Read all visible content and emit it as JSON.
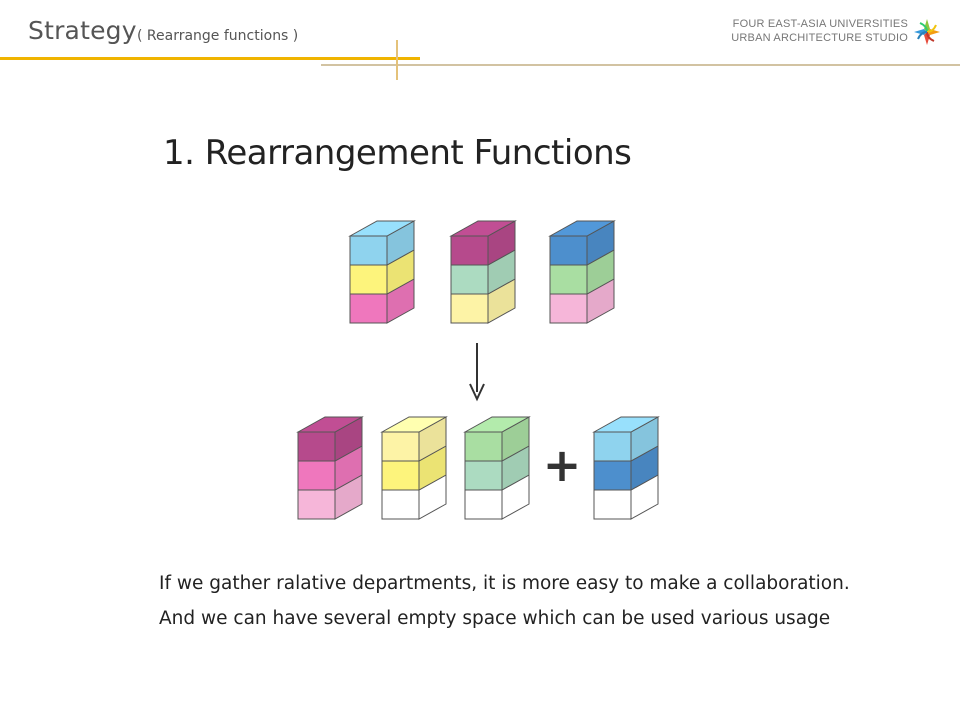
{
  "header": {
    "title": "Strategy",
    "subtitle": "( Rearrange functions )",
    "org_line1": "FOUR EAST-ASIA  UNIVERSITIES",
    "org_line2": "URBAN ARCHITECTURE STUDIO",
    "logo_icon": "four-color-pinwheel-logo"
  },
  "figure": {
    "title": "1. Rearrangement Functions",
    "operator_symbol": "+",
    "arrow_icon": "arrow-down-icon",
    "colors": {
      "cyan": "#8fd3ee",
      "yellow": "#fdf47c",
      "pink": "#ef77bd",
      "magenta": "#b64a8c",
      "mint": "#acdbc1",
      "cream": "#fdf3a6",
      "blue": "#4d8fcd",
      "green": "#a9dea2",
      "light_pink": "#f6b6d9",
      "empty": "#ffffff"
    },
    "stacks_before": [
      [
        "cyan",
        "yellow",
        "pink"
      ],
      [
        "magenta",
        "mint",
        "cream"
      ],
      [
        "blue",
        "green",
        "light_pink"
      ]
    ],
    "stacks_after": [
      [
        "magenta",
        "pink",
        "light_pink"
      ],
      [
        "cream",
        "yellow",
        "empty"
      ],
      [
        "green",
        "mint",
        "empty"
      ],
      [
        "cyan",
        "blue",
        "empty"
      ]
    ]
  },
  "body": {
    "line1": "If we gather ralative departments,  it is more easy to make a collaboration.",
    "line2": "And we can have several empty space which can be used various usage"
  }
}
